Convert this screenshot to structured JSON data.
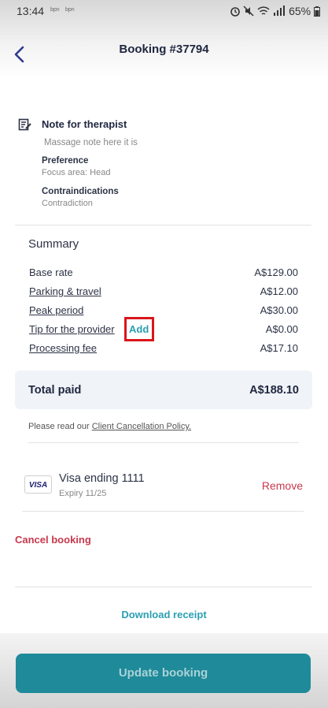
{
  "status_bar": {
    "time": "13:44",
    "small_icons": "bpn",
    "right": "65%"
  },
  "header": {
    "title": "Booking #37794"
  },
  "note": {
    "heading": "Note for therapist",
    "text": "Massage note here it is",
    "preference_label": "Preference",
    "preference_value": "Focus area: Head",
    "contra_label": "Contraindications",
    "contra_value": "Contradiction"
  },
  "summary": {
    "title": "Summary",
    "rows": [
      {
        "label": "Base rate",
        "amount": "A$129.00"
      },
      {
        "label": "Parking & travel",
        "amount": "A$12.00"
      },
      {
        "label": "Peak period",
        "amount": "A$30.00"
      },
      {
        "label": "Tip for the provider",
        "amount": "A$0.00",
        "action": "Add"
      },
      {
        "label": "Processing fee",
        "amount": "A$17.10"
      }
    ],
    "total_label": "Total paid",
    "total_amount": "A$188.10"
  },
  "policy": {
    "prefix": "Please read our ",
    "link": "Client Cancellation Policy."
  },
  "payment": {
    "brand": "VISA",
    "card_label": "Visa ending 1111",
    "expiry": "Expiry 11/25",
    "remove_label": "Remove"
  },
  "actions": {
    "cancel_label": "Cancel booking",
    "download_label": "Download receipt",
    "update_label": "Update booking"
  },
  "colors": {
    "accent": "#2a9fb1",
    "danger": "#c8384d",
    "button": "#1f8a99"
  }
}
